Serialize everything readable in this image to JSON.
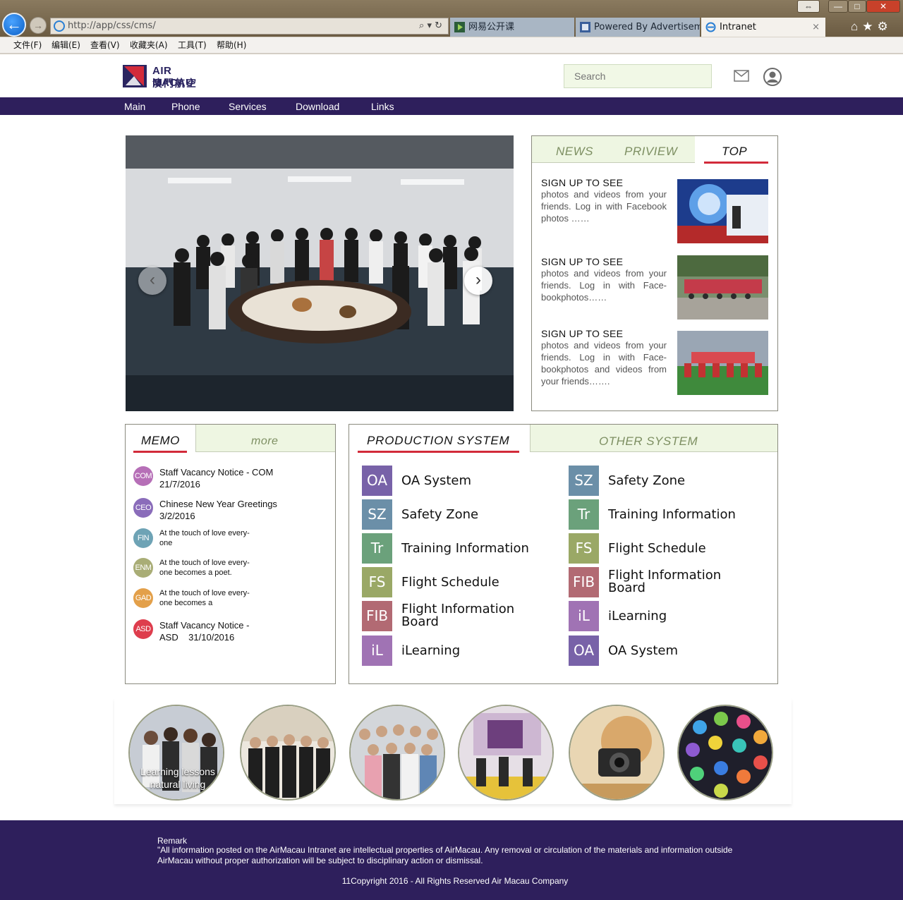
{
  "browser": {
    "address": "http://app/css/cms/",
    "tabs": [
      {
        "label": "网易公开课"
      },
      {
        "label": "Powered By Advertisem..."
      },
      {
        "label": "Intranet"
      }
    ],
    "tab_close": "×",
    "menu": [
      "文件(F)",
      "编辑(E)",
      "查看(V)",
      "收藏夹(A)",
      "工具(T)",
      "帮助(H)"
    ],
    "window_buttons": {
      "minimize": "—",
      "maximize": "□",
      "close": "✕"
    }
  },
  "header": {
    "logo_en": "AIR MACAU",
    "logo_cn": "澳門航空",
    "search_placeholder": "Search"
  },
  "nav": [
    "Main",
    "Phone",
    "Services",
    "Download",
    "Links"
  ],
  "news": {
    "tabs": [
      "NEWS",
      "PRIVIEW",
      "TOP"
    ],
    "active_tab": "TOP",
    "items": [
      {
        "title": "SIGN UP TO SEE",
        "body": "photos and videos from your friends. Log in with Facebook photos ……"
      },
      {
        "title": "SIGN UP TO SEE",
        "body": "photos and videos from your friends. Log in with Face-bookphotos……"
      },
      {
        "title": "SIGN UP TO SEE",
        "body": "photos and videos from your friends. Log in with Face-bookphotos and videos from your friends……."
      }
    ]
  },
  "memo": {
    "title": "MEMO",
    "more": "more",
    "items": [
      {
        "badge": "COM",
        "color": "#b66fb7",
        "line1": "Staff Vacancy Notice - COM",
        "line2": "21/7/2016",
        "size": "big"
      },
      {
        "badge": "CEO",
        "color": "#8a6cba",
        "line1": "Chinese New Year Greetings",
        "line2": "3/2/2016",
        "size": "big"
      },
      {
        "badge": "FIN",
        "color": "#6ea3b5",
        "line1": "At the touch of love every-",
        "line2": "one",
        "size": "small"
      },
      {
        "badge": "ENM",
        "color": "#a9ad76",
        "line1": "At the touch of love every-",
        "line2": "one becomes a poet.",
        "size": "small"
      },
      {
        "badge": "GAD",
        "color": "#e3a04a",
        "line1": "At the touch of love every-",
        "line2": "one becomes a",
        "size": "small"
      },
      {
        "badge": "ASD",
        "color": "#de3d4d",
        "line1": "Staff Vacancy Notice -",
        "line2": "ASD    31/10/2016",
        "size": "big"
      }
    ]
  },
  "systems": {
    "production_title": "PRODUCTION  SYSTEM",
    "other_title": "OTHER SYSTEM",
    "production": [
      {
        "badge": "OA",
        "label": "OA System",
        "color": "#7862a8"
      },
      {
        "badge": "SZ",
        "label": "Safety Zone",
        "color": "#6b8fa8"
      },
      {
        "badge": "Tr",
        "label": "Training Information",
        "color": "#6ba17b"
      },
      {
        "badge": "FS",
        "label": "Flight Schedule",
        "color": "#9aa866"
      },
      {
        "badge": "FIB",
        "label": "Flight Information Board",
        "color": "#b26a73"
      },
      {
        "badge": "iL",
        "label": "iLearning",
        "color": "#a073b4"
      }
    ],
    "other": [
      {
        "badge": "SZ",
        "label": "Safety Zone",
        "color": "#6b8fa8"
      },
      {
        "badge": "Tr",
        "label": "Training Information",
        "color": "#6ba17b"
      },
      {
        "badge": "FS",
        "label": "Flight Schedule",
        "color": "#9aa866"
      },
      {
        "badge": "FIB",
        "label": "Flight Information Board",
        "color": "#b26a73"
      },
      {
        "badge": "iL",
        "label": "iLearning",
        "color": "#a073b4"
      },
      {
        "badge": "OA",
        "label": "OA System",
        "color": "#7862a8"
      }
    ]
  },
  "circles": [
    {
      "caption": "Learning lessons natural living"
    },
    {
      "caption": ""
    },
    {
      "caption": ""
    },
    {
      "caption": ""
    },
    {
      "caption": ""
    },
    {
      "caption": ""
    }
  ],
  "footer": {
    "remark_title": "Remark",
    "remark_text": "\"All information posted on the AirMacau Intranet are intellectual properties of AirMacau. Any removal or circulation of the materials and information outside AirMacau without proper authorization will be subject to disciplinary action or dismissal.",
    "copyright": "11Copyright 2016 - All Rights Reserved Air Macau Company"
  },
  "colors": {
    "brand_purple": "#2e1f5c",
    "accent_red": "#d22b3a",
    "tab_green": "#eef6e2"
  }
}
